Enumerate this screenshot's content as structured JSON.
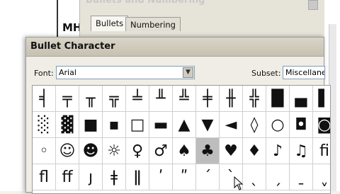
{
  "document": {
    "visible_text": "MH"
  },
  "background_dialog": {
    "title": "Bullets and Numbering",
    "tabs": [
      {
        "label": "Bullets"
      },
      {
        "label": "Numbering"
      }
    ]
  },
  "dialog": {
    "title": "Bullet Character",
    "font_label": "Font:",
    "font_value": "Arial",
    "subset_label": "Subset:",
    "subset_value": "Miscellane",
    "selected_glyph": "♣",
    "glyphs": [
      "╡",
      "╤",
      "╥",
      "╦",
      "╧",
      "╨",
      "╩",
      "╪",
      "╫",
      "╬",
      "█",
      "▄",
      "▌",
      "░",
      "▓",
      "■",
      "▪",
      "□",
      "▬",
      "▲",
      "▼",
      "◄",
      "◊",
      "○",
      "◘",
      "◙",
      "◦",
      "☺",
      "☻",
      "☼",
      "♀",
      "♂",
      "♠",
      "♣",
      "♥",
      "♦",
      "♪",
      "♫",
      "ﬁ",
      "ﬂ",
      "ﬀ",
      "ȷ",
      "ǂ",
      "ǁ",
      "ʹ",
      "ʺ",
      "ˊ",
      "ˋ",
      "ˎ",
      "ˏ",
      "ˍ",
      "ˬ"
    ]
  },
  "colors": {
    "title_bar": "#c6c1b1",
    "selection": "#bdbdbd"
  }
}
